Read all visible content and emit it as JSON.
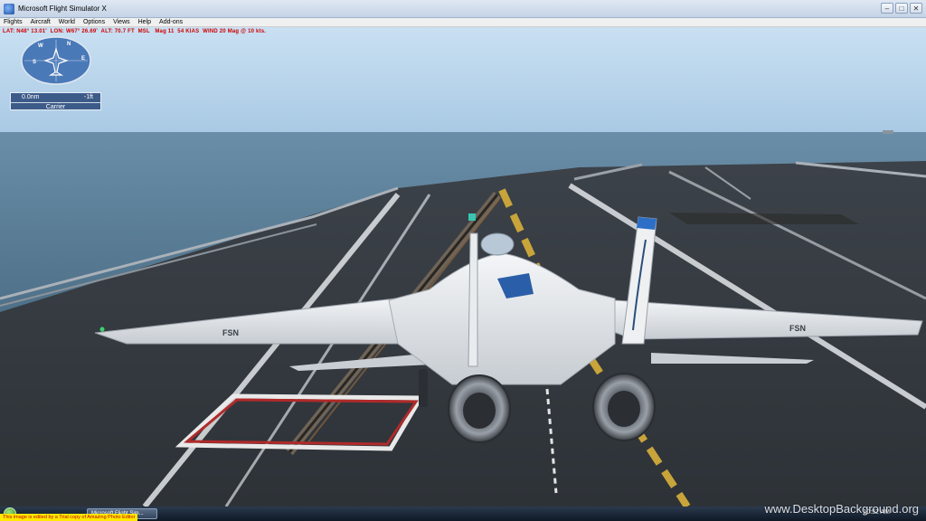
{
  "window": {
    "title": "Microsoft Flight Simulator X",
    "controls": {
      "minimize": "–",
      "maximize": "□",
      "close": "✕"
    }
  },
  "menu": {
    "items": [
      "Flights",
      "Aircraft",
      "World",
      "Options",
      "Views",
      "Help",
      "Add-ons"
    ]
  },
  "hud": {
    "status_line": "LAT: N48° 13.01'  LON: W67° 26.69'  ALT: 70.7 FT  MSL   Mag 11  54 KIAS  WIND 20 Mag @ 10 kts."
  },
  "compass": {
    "north": "N",
    "east": "E",
    "south": "S",
    "west": "W"
  },
  "distance_box": {
    "distance": "0.0nm",
    "altitude": "-1ft",
    "target": "Carrier"
  },
  "aircraft": {
    "wing_marking_left": "FSN",
    "wing_marking_right": "FSN"
  },
  "taskbar": {
    "task_button": "Microsoft Flight Sim...",
    "clock": "10:52 AM"
  },
  "overlay": {
    "trial_notice": "This image is edited by a Trial copy of Amazing Photo Editor",
    "watermark": "www.DesktopBackground.org"
  },
  "colors": {
    "sky": "#b8d6ee",
    "sea": "#5a7f9a",
    "deck": "#3a3f45",
    "hud_text": "#d00000"
  }
}
